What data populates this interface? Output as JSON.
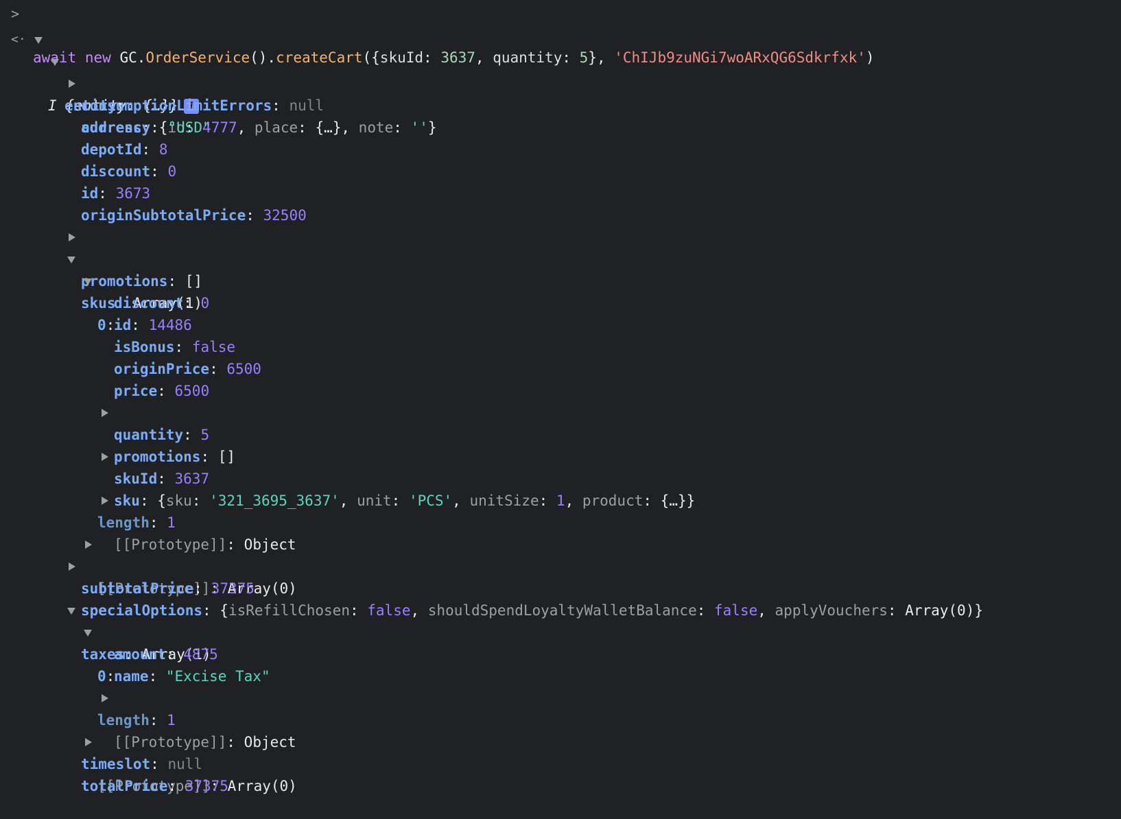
{
  "command": {
    "prompt_symbol": ">",
    "kw_await": "await",
    "kw_new": "new",
    "ns": "GC.",
    "cls": "OrderService",
    "call": "().",
    "method": "createCart",
    "open": "({",
    "arg_key1": "skuId",
    "arg_val1": "3637",
    "arg_key2": "quantity",
    "arg_val2": "5",
    "mid": "}, ",
    "arg_str": "'ChIJb9zuNGi7woARxQG6Sdkrfxk'",
    "close": ")"
  },
  "result": {
    "return_symbol": "<·",
    "class_name": "I",
    "preview": "{entity: {…}}",
    "info_glyph": "i"
  },
  "entity": {
    "label": "entity",
    "address": {
      "key": "address",
      "preview_id_key": "id",
      "preview_id_val": "4777",
      "preview_place_key": "place",
      "preview_place_val": "{…}",
      "preview_note_key": "note",
      "preview_note_val": "''"
    },
    "consumptionLimitErrors": {
      "key": "consumptionLimitErrors",
      "value": "null"
    },
    "currency": {
      "key": "currency",
      "value": "\"USD\""
    },
    "depotId": {
      "key": "depotId",
      "value": "8"
    },
    "discount": {
      "key": "discount",
      "value": "0"
    },
    "id": {
      "key": "id",
      "value": "3673"
    },
    "originSubtotalPrice": {
      "key": "originSubtotalPrice",
      "value": "32500"
    },
    "promotions": {
      "key": "promotions",
      "value": "[]"
    },
    "skus": {
      "key": "skus",
      "value": "Array(1)",
      "item0": {
        "key": "0",
        "discount": {
          "key": "discount",
          "value": "0"
        },
        "id": {
          "key": "id",
          "value": "14486"
        },
        "isBonus": {
          "key": "isBonus",
          "value": "false"
        },
        "originPrice": {
          "key": "originPrice",
          "value": "6500"
        },
        "price": {
          "key": "price",
          "value": "6500"
        },
        "promotions": {
          "key": "promotions",
          "value": "[]"
        },
        "quantity": {
          "key": "quantity",
          "value": "5"
        },
        "sku": {
          "key": "sku",
          "p_sku_key": "sku",
          "p_sku_val": "'321_3695_3637'",
          "p_unit_key": "unit",
          "p_unit_val": "'PCS'",
          "p_unitsize_key": "unitSize",
          "p_unitsize_val": "1",
          "p_product_key": "product",
          "p_product_val": "{…}"
        },
        "skuId": {
          "key": "skuId",
          "value": "3637"
        },
        "prototype": {
          "key": "[[Prototype]]",
          "value": "Object"
        }
      },
      "length": {
        "key": "length",
        "value": "1"
      },
      "prototype": {
        "key": "[[Prototype]]",
        "value": "Array(0)"
      }
    },
    "specialOptions": {
      "key": "specialOptions",
      "p1_key": "isRefillChosen",
      "p1_val": "false",
      "p2_key": "shouldSpendLoyaltyWalletBalance",
      "p2_val": "false",
      "p3_key": "applyVouchers",
      "p3_val": "Array(0)"
    },
    "subtotalPrice": {
      "key": "subtotalPrice",
      "value": "37375"
    },
    "taxes": {
      "key": "taxes",
      "value": "Array(1)",
      "item0": {
        "key": "0",
        "amount": {
          "key": "amount",
          "value": "4875"
        },
        "name": {
          "key": "name",
          "value": "\"Excise Tax\""
        },
        "prototype": {
          "key": "[[Prototype]]",
          "value": "Object"
        }
      },
      "length": {
        "key": "length",
        "value": "1"
      },
      "prototype": {
        "key": "[[Prototype]]",
        "value": "Array(0)"
      }
    },
    "timeslot": {
      "key": "timeslot",
      "value": "null"
    },
    "totalPrice": {
      "key": "totalPrice",
      "value": "37375"
    }
  }
}
